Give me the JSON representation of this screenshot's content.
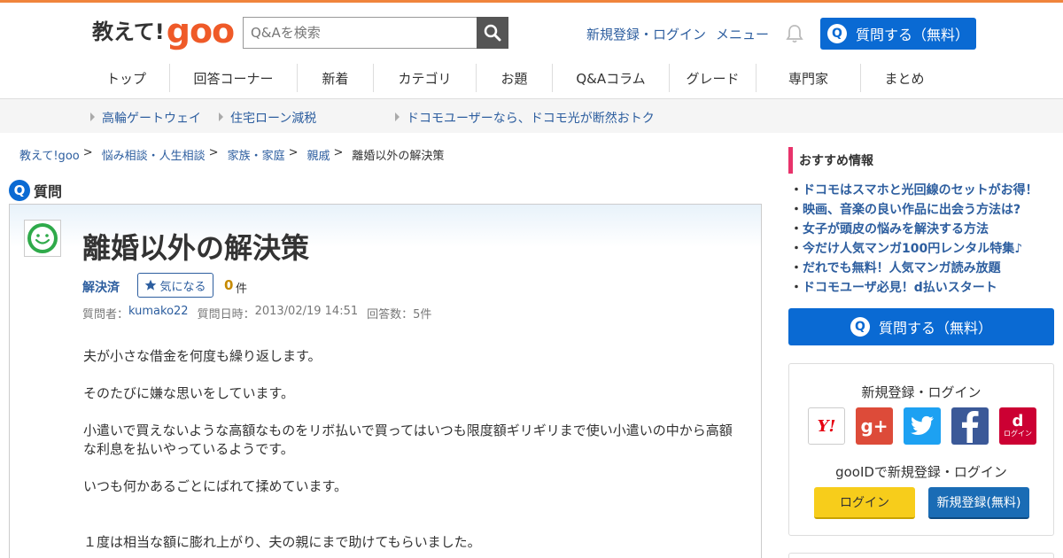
{
  "header": {
    "logo_text": "教えて!",
    "logo_goo": "goo",
    "search_placeholder": "Q&Aを検索",
    "register_login": "新規登録・ログイン",
    "menu": "メニュー",
    "ask_label": "質問する（無料）"
  },
  "nav": {
    "items": [
      "トップ",
      "回答コーナー",
      "新着",
      "カテゴリ",
      "お題",
      "Q&Aコラム",
      "グレード",
      "専門家",
      "まとめ"
    ]
  },
  "promo": {
    "items": [
      "高輪ゲートウェイ",
      "住宅ローン減税",
      "ドコモユーザーなら、ドコモ光が断然おトク"
    ]
  },
  "breadcrumb": {
    "items": [
      "教えて!goo",
      "悩み相談・人生相談",
      "家族・家庭",
      "親戚"
    ],
    "current": "離婚以外の解決策",
    "sep": ">"
  },
  "question": {
    "section_label": "質問",
    "badge": "Q",
    "title": "離婚以外の解決策",
    "status": "解決済",
    "kini_label": "気になる",
    "kini_count": "0",
    "kini_unit": "件",
    "meta_asker_label": "質問者：",
    "meta_asker": "kumako22",
    "meta_date_label": "質問日時：",
    "meta_date": "2013/02/19 14:51",
    "meta_answers_label": "回答数：",
    "meta_answers": "5件",
    "body": [
      "夫が小さな借金を何度も繰り返します。",
      "そのたびに嫌な思いをしています。",
      "小遣いで買えないような高額なものをリボ払いで買ってはいつも限度額ギリギリまで使い小遣いの中から高額な利息を払いやっているようです。",
      "いつも何かあるごとにばれて揉めています。",
      "１度は相当な額に膨れ上がり、夫の親にまで助けてもらいました。"
    ]
  },
  "sidebar": {
    "rec_head": "おすすめ情報",
    "rec_items": [
      "ドコモはスマホと光回線のセットがお得！",
      "映画、音楽の良い作品に出会う方法は?",
      "女子が頭皮の悩みを解決する方法",
      "今だけ人気マンガ100円レンタル特集♪",
      "だれでも無料！人気マンガ読み放題",
      "ドコモユーザ必見！d払いスタート"
    ],
    "ask_label": "質問する（無料）",
    "login_title": "新規登録・ログイン",
    "sns": {
      "yahoo": "Y!",
      "google": "g+",
      "docomo_d": "d",
      "docomo_sub": "ログイン"
    },
    "gooid_title": "gooIDで新規登録・ログイン",
    "login_btn": "ログイン",
    "register_btn": "新規登録(無料)"
  },
  "colors": {
    "accent_blue": "#0a6ad3",
    "goo_orange": "#ef5a28",
    "link": "#2d5e9f",
    "pink_marker": "#e8336b"
  }
}
